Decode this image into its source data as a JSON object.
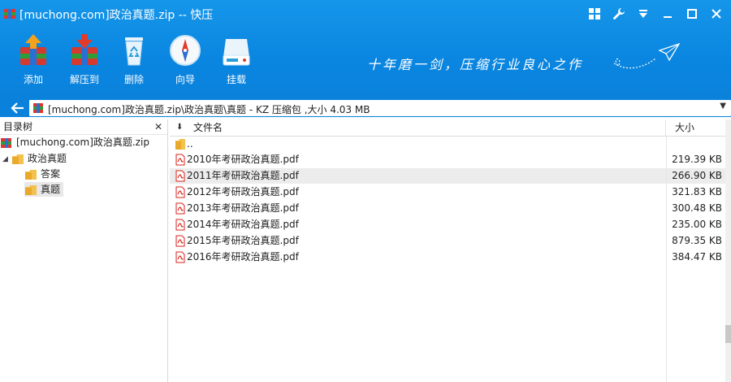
{
  "window": {
    "title": "[muchong.com]政治真题.zip -- 快压",
    "controls": [
      "grid-icon",
      "wrench-icon",
      "menu-icon",
      "minimize-icon",
      "maximize-icon",
      "close-icon"
    ]
  },
  "toolbar": {
    "buttons": [
      {
        "label": "添加",
        "icon": "add-archive-icon"
      },
      {
        "label": "解压到",
        "icon": "extract-icon"
      },
      {
        "label": "删除",
        "icon": "recycle-bin-icon"
      },
      {
        "label": "向导",
        "icon": "compass-icon"
      },
      {
        "label": "挂载",
        "icon": "disk-mount-icon"
      }
    ],
    "slogan": "十年磨一剑，压缩行业良心之作"
  },
  "address": {
    "path": "[muchong.com]政治真题.zip\\政治真题\\真题 - KZ 压缩包 ,大小 4.03 MB"
  },
  "tree": {
    "header": "目录树",
    "root": "[muchong.com]政治真题.zip",
    "folder": "政治真题",
    "children": [
      "答案",
      "真题"
    ],
    "selected": "真题"
  },
  "files": {
    "col_name": "文件名",
    "col_size": "大小",
    "parent": "..",
    "rows": [
      {
        "name": "2010年考研政治真题.pdf",
        "size": "219.39 KB"
      },
      {
        "name": "2011年考研政治真题.pdf",
        "size": "266.90 KB"
      },
      {
        "name": "2012年考研政治真题.pdf",
        "size": "321.83 KB"
      },
      {
        "name": "2013年考研政治真题.pdf",
        "size": "300.48 KB"
      },
      {
        "name": "2014年考研政治真题.pdf",
        "size": "235.00 KB"
      },
      {
        "name": "2015年考研政治真题.pdf",
        "size": "879.35 KB"
      },
      {
        "name": "2016年考研政治真题.pdf",
        "size": "384.47 KB"
      }
    ],
    "highlighted_row": 1
  },
  "colors": {
    "accent": "#0a86e0",
    "folder": "#f2c14e",
    "pdf": "#d9231d"
  }
}
